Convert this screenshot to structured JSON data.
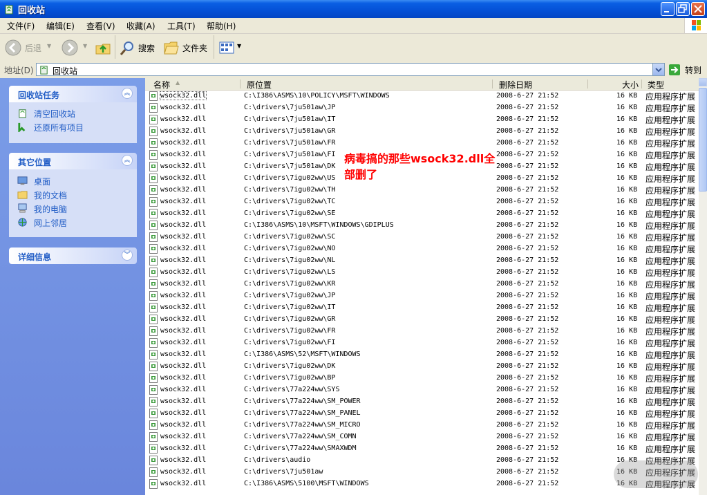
{
  "window": {
    "title": "回收站"
  },
  "menu": [
    "文件(F)",
    "编辑(E)",
    "查看(V)",
    "收藏(A)",
    "工具(T)",
    "帮助(H)"
  ],
  "toolbar": {
    "back": "后退",
    "search": "搜索",
    "folders": "文件夹"
  },
  "address": {
    "label": "地址(D)",
    "value": "回收站",
    "go": "转到"
  },
  "panels": [
    {
      "title": "回收站任务",
      "items": [
        {
          "label": "清空回收站",
          "icon": "empty-bin-icon"
        },
        {
          "label": "还原所有项目",
          "icon": "restore-icon"
        }
      ]
    },
    {
      "title": "其它位置",
      "items": [
        {
          "label": "桌面",
          "icon": "desktop-icon"
        },
        {
          "label": "我的文档",
          "icon": "my-documents-icon"
        },
        {
          "label": "我的电脑",
          "icon": "my-computer-icon"
        },
        {
          "label": "网上邻居",
          "icon": "network-icon"
        }
      ]
    },
    {
      "title": "详细信息",
      "items": []
    }
  ],
  "columns": {
    "name": "名称",
    "location": "原位置",
    "date": "删除日期",
    "size": "大小",
    "type": "类型"
  },
  "files": [
    {
      "name": "wsock32.dll",
      "loc": "C:\\I386\\ASMS\\10\\POLICY\\MSFT\\WINDOWS",
      "date": "2008-6-27 21:52",
      "size": "16 KB",
      "type": "应用程序扩展"
    },
    {
      "name": "wsock32.dll",
      "loc": "C:\\drivers\\7ju501aw\\JP",
      "date": "2008-6-27 21:52",
      "size": "16 KB",
      "type": "应用程序扩展"
    },
    {
      "name": "wsock32.dll",
      "loc": "C:\\drivers\\7ju501aw\\IT",
      "date": "2008-6-27 21:52",
      "size": "16 KB",
      "type": "应用程序扩展"
    },
    {
      "name": "wsock32.dll",
      "loc": "C:\\drivers\\7ju501aw\\GR",
      "date": "2008-6-27 21:52",
      "size": "16 KB",
      "type": "应用程序扩展"
    },
    {
      "name": "wsock32.dll",
      "loc": "C:\\drivers\\7ju501aw\\FR",
      "date": "2008-6-27 21:52",
      "size": "16 KB",
      "type": "应用程序扩展"
    },
    {
      "name": "wsock32.dll",
      "loc": "C:\\drivers\\7ju501aw\\FI",
      "date": "2008-6-27 21:52",
      "size": "16 KB",
      "type": "应用程序扩展"
    },
    {
      "name": "wsock32.dll",
      "loc": "C:\\drivers\\7ju501aw\\DK",
      "date": "2008-6-27 21:52",
      "size": "16 KB",
      "type": "应用程序扩展"
    },
    {
      "name": "wsock32.dll",
      "loc": "C:\\drivers\\7igu02ww\\US",
      "date": "2008-6-27 21:52",
      "size": "16 KB",
      "type": "应用程序扩展"
    },
    {
      "name": "wsock32.dll",
      "loc": "C:\\drivers\\7igu02ww\\TH",
      "date": "2008-6-27 21:52",
      "size": "16 KB",
      "type": "应用程序扩展"
    },
    {
      "name": "wsock32.dll",
      "loc": "C:\\drivers\\7igu02ww\\TC",
      "date": "2008-6-27 21:52",
      "size": "16 KB",
      "type": "应用程序扩展"
    },
    {
      "name": "wsock32.dll",
      "loc": "C:\\drivers\\7igu02ww\\SE",
      "date": "2008-6-27 21:52",
      "size": "16 KB",
      "type": "应用程序扩展"
    },
    {
      "name": "wsock32.dll",
      "loc": "C:\\I386\\ASMS\\10\\MSFT\\WINDOWS\\GDIPLUS",
      "date": "2008-6-27 21:52",
      "size": "16 KB",
      "type": "应用程序扩展"
    },
    {
      "name": "wsock32.dll",
      "loc": "C:\\drivers\\7igu02ww\\SC",
      "date": "2008-6-27 21:52",
      "size": "16 KB",
      "type": "应用程序扩展"
    },
    {
      "name": "wsock32.dll",
      "loc": "C:\\drivers\\7igu02ww\\NO",
      "date": "2008-6-27 21:52",
      "size": "16 KB",
      "type": "应用程序扩展"
    },
    {
      "name": "wsock32.dll",
      "loc": "C:\\drivers\\7igu02ww\\NL",
      "date": "2008-6-27 21:52",
      "size": "16 KB",
      "type": "应用程序扩展"
    },
    {
      "name": "wsock32.dll",
      "loc": "C:\\drivers\\7igu02ww\\LS",
      "date": "2008-6-27 21:52",
      "size": "16 KB",
      "type": "应用程序扩展"
    },
    {
      "name": "wsock32.dll",
      "loc": "C:\\drivers\\7igu02ww\\KR",
      "date": "2008-6-27 21:52",
      "size": "16 KB",
      "type": "应用程序扩展"
    },
    {
      "name": "wsock32.dll",
      "loc": "C:\\drivers\\7igu02ww\\JP",
      "date": "2008-6-27 21:52",
      "size": "16 KB",
      "type": "应用程序扩展"
    },
    {
      "name": "wsock32.dll",
      "loc": "C:\\drivers\\7igu02ww\\IT",
      "date": "2008-6-27 21:52",
      "size": "16 KB",
      "type": "应用程序扩展"
    },
    {
      "name": "wsock32.dll",
      "loc": "C:\\drivers\\7igu02ww\\GR",
      "date": "2008-6-27 21:52",
      "size": "16 KB",
      "type": "应用程序扩展"
    },
    {
      "name": "wsock32.dll",
      "loc": "C:\\drivers\\7igu02ww\\FR",
      "date": "2008-6-27 21:52",
      "size": "16 KB",
      "type": "应用程序扩展"
    },
    {
      "name": "wsock32.dll",
      "loc": "C:\\drivers\\7igu02ww\\FI",
      "date": "2008-6-27 21:52",
      "size": "16 KB",
      "type": "应用程序扩展"
    },
    {
      "name": "wsock32.dll",
      "loc": "C:\\I386\\ASMS\\52\\MSFT\\WINDOWS",
      "date": "2008-6-27 21:52",
      "size": "16 KB",
      "type": "应用程序扩展"
    },
    {
      "name": "wsock32.dll",
      "loc": "C:\\drivers\\7igu02ww\\DK",
      "date": "2008-6-27 21:52",
      "size": "16 KB",
      "type": "应用程序扩展"
    },
    {
      "name": "wsock32.dll",
      "loc": "C:\\drivers\\7igu02ww\\BP",
      "date": "2008-6-27 21:52",
      "size": "16 KB",
      "type": "应用程序扩展"
    },
    {
      "name": "wsock32.dll",
      "loc": "C:\\drivers\\77a224ww\\SYS",
      "date": "2008-6-27 21:52",
      "size": "16 KB",
      "type": "应用程序扩展"
    },
    {
      "name": "wsock32.dll",
      "loc": "C:\\drivers\\77a224ww\\SM_POWER",
      "date": "2008-6-27 21:52",
      "size": "16 KB",
      "type": "应用程序扩展"
    },
    {
      "name": "wsock32.dll",
      "loc": "C:\\drivers\\77a224ww\\SM_PANEL",
      "date": "2008-6-27 21:52",
      "size": "16 KB",
      "type": "应用程序扩展"
    },
    {
      "name": "wsock32.dll",
      "loc": "C:\\drivers\\77a224ww\\SM_MICRO",
      "date": "2008-6-27 21:52",
      "size": "16 KB",
      "type": "应用程序扩展"
    },
    {
      "name": "wsock32.dll",
      "loc": "C:\\drivers\\77a224ww\\SM_COMN",
      "date": "2008-6-27 21:52",
      "size": "16 KB",
      "type": "应用程序扩展"
    },
    {
      "name": "wsock32.dll",
      "loc": "C:\\drivers\\77a224ww\\SMAXWDM",
      "date": "2008-6-27 21:52",
      "size": "16 KB",
      "type": "应用程序扩展"
    },
    {
      "name": "wsock32.dll",
      "loc": "C:\\drivers\\audio",
      "date": "2008-6-27 21:52",
      "size": "16 KB",
      "type": "应用程序扩展"
    },
    {
      "name": "wsock32.dll",
      "loc": "C:\\drivers\\7ju501aw",
      "date": "2008-6-27 21:52",
      "size": "16 KB",
      "type": "应用程序扩展"
    },
    {
      "name": "wsock32.dll",
      "loc": "C:\\I386\\ASMS\\5100\\MSFT\\WINDOWS",
      "date": "2008-6-27 21:52",
      "size": "16 KB",
      "type": "应用程序扩展"
    }
  ],
  "annotation": {
    "line1": "病毒搞的那些wsock32.dll全",
    "line2": "部删了"
  }
}
